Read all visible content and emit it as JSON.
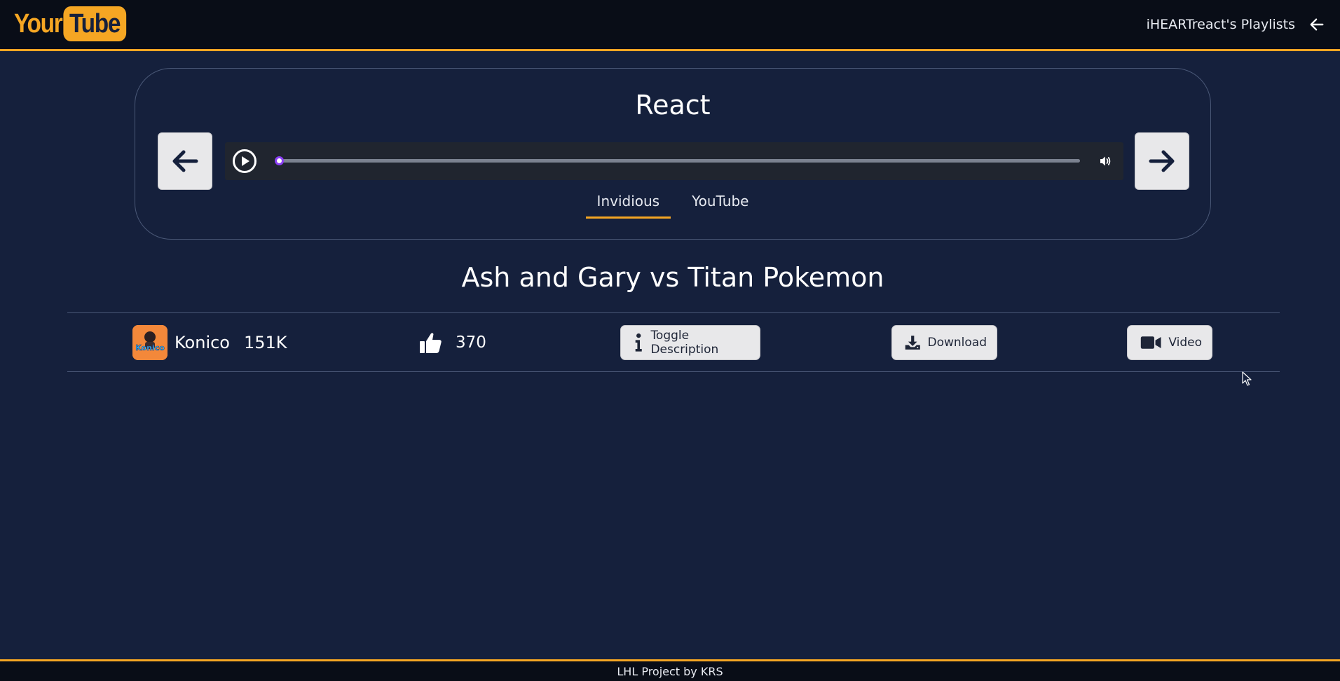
{
  "header": {
    "logo_your": "Your",
    "logo_tube": "Tube",
    "playlists_link": "iHEARTreact's Playlists",
    "back_icon": "arrow-left-icon"
  },
  "player": {
    "playlist_title": "React",
    "prev_icon": "arrow-left-icon",
    "next_icon": "arrow-right-icon",
    "play_icon": "play-circle-icon",
    "volume_icon": "volume-icon",
    "progress_fraction": 0.004,
    "source_tabs": [
      {
        "label": "Invidious",
        "active": true
      },
      {
        "label": "YouTube",
        "active": false
      }
    ]
  },
  "video": {
    "title": "Ash and Gary vs Titan Pokemon",
    "channel_name": "Konico",
    "channel_avatar_text": "Konico",
    "subscribers": "151K",
    "likes": "370",
    "toggle_description_label": "Toggle Description",
    "download_label": "Download",
    "video_label": "Video"
  },
  "footer": {
    "text": "LHL Project by KRS"
  },
  "colors": {
    "background": "#15203c",
    "bar": "#090d17",
    "accent": "#f5a623",
    "button_bg": "#e8e8ea",
    "slider_thumb": "#8b3ff5"
  }
}
